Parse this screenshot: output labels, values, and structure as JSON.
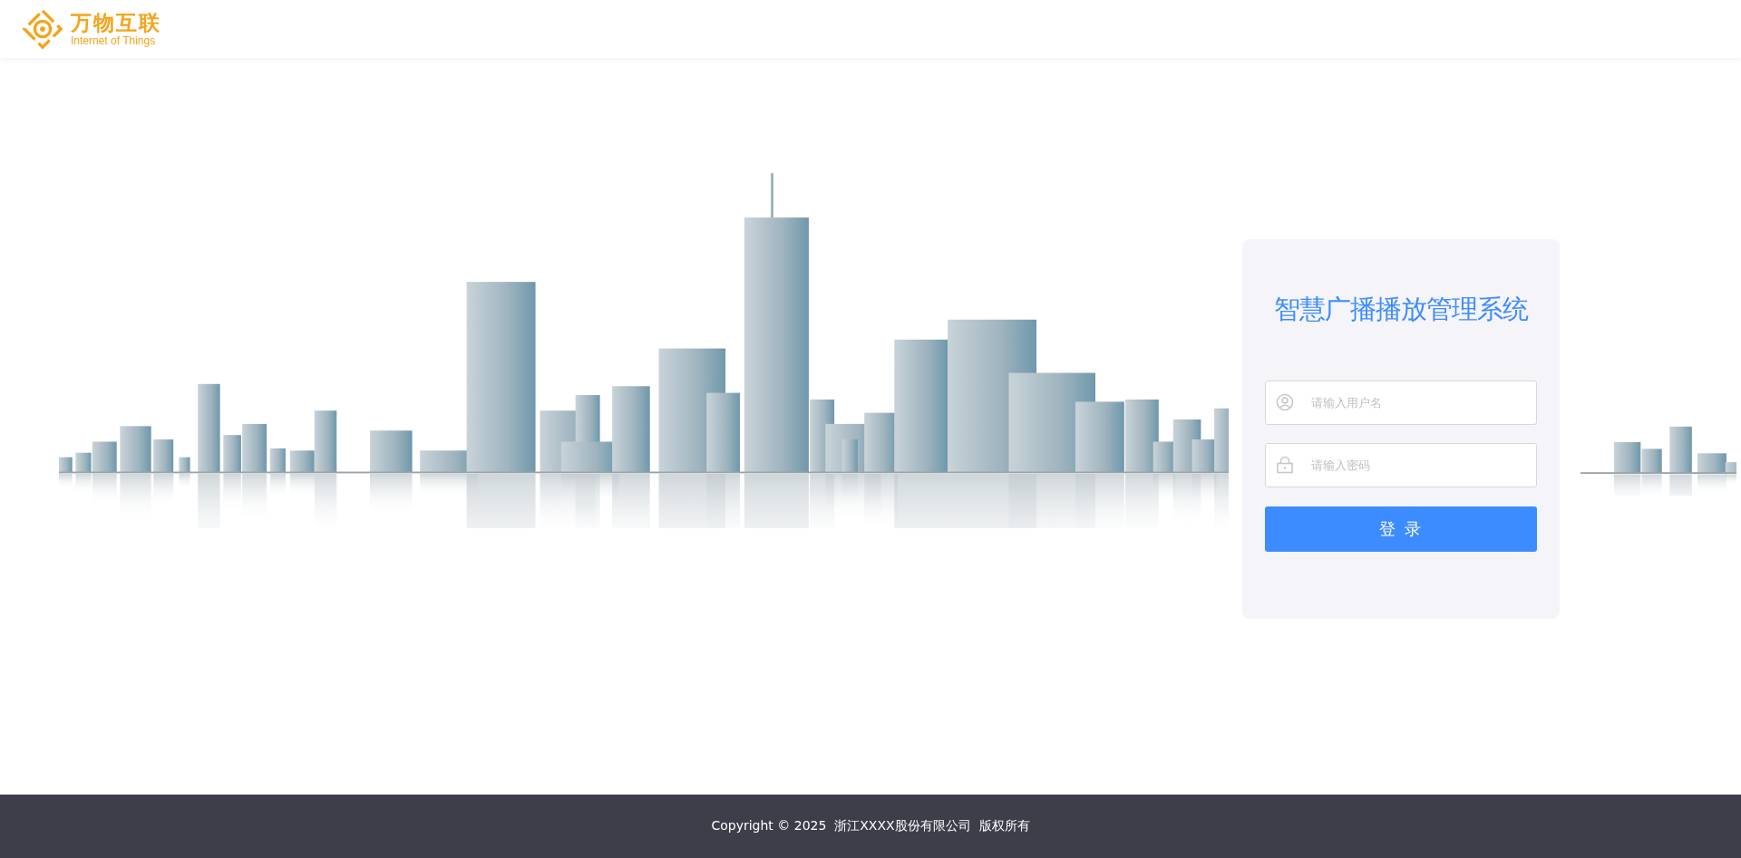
{
  "header": {
    "logo_title": "万物互联",
    "logo_subtitle": "Internet of Things"
  },
  "login": {
    "title": "智慧广播播放管理系统",
    "username": {
      "placeholder": "请输入用户名"
    },
    "password": {
      "placeholder": "请输入密码"
    },
    "submit": "登 录"
  },
  "footer": {
    "copyright": "Copyright © 2025  浙江XXXX股份有限公司  版权所有"
  }
}
